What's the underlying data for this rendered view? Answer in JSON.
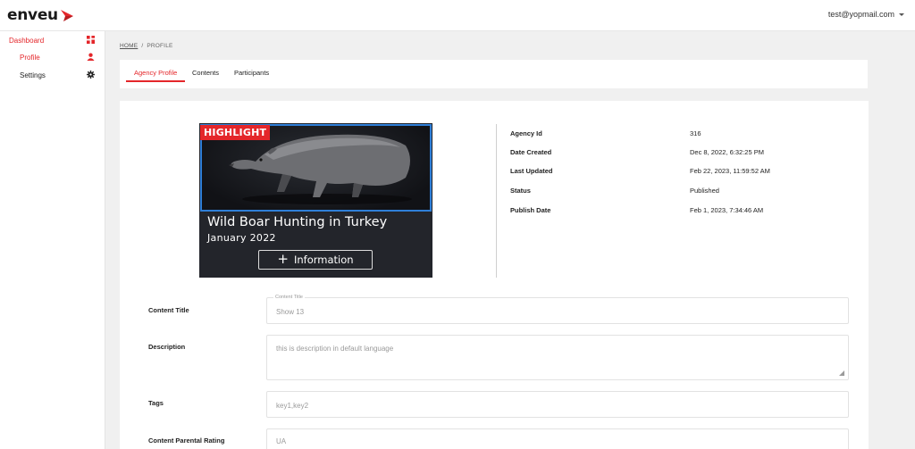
{
  "app": {
    "logo_text": "enveu",
    "brand_color": "#e4262a"
  },
  "header": {
    "user_email": "test@yopmail.com"
  },
  "sidebar": {
    "items": [
      {
        "label": "Dashboard",
        "icon": "dashboard-grid-icon"
      },
      {
        "label": "Profile",
        "icon": "user-profile-icon"
      },
      {
        "label": "Settings",
        "icon": "gear-icon"
      }
    ]
  },
  "breadcrumb": {
    "home": "HOME",
    "separator": "/",
    "current": "PROFILE"
  },
  "tabs": [
    {
      "label": "Agency Profile",
      "active": true
    },
    {
      "label": "Contents",
      "active": false
    },
    {
      "label": "Participants",
      "active": false
    }
  ],
  "hero": {
    "badge": "HIGHLIGHT",
    "title": "Wild Boar Hunting in Turkey",
    "subtitle": "January 2022",
    "button_label": "Information",
    "image": "wild-boar-image"
  },
  "details": [
    {
      "label": "Agency Id",
      "value": "316"
    },
    {
      "label": "Date Created",
      "value": "Dec 8, 2022, 6:32:25 PM"
    },
    {
      "label": "Last Updated",
      "value": "Feb 22, 2023, 11:59:52 AM"
    },
    {
      "label": "Status",
      "value": "Published"
    },
    {
      "label": "Publish Date",
      "value": "Feb 1, 2023, 7:34:46 AM"
    }
  ],
  "form": {
    "content_title": {
      "label": "Content Title",
      "floating_label": "Content Title",
      "value": "Show 13"
    },
    "description": {
      "label": "Description",
      "value": "this is description in default language"
    },
    "tags": {
      "label": "Tags",
      "value": "key1,key2"
    },
    "parental_rating": {
      "label": "Content Parental Rating",
      "value": "UA"
    }
  }
}
